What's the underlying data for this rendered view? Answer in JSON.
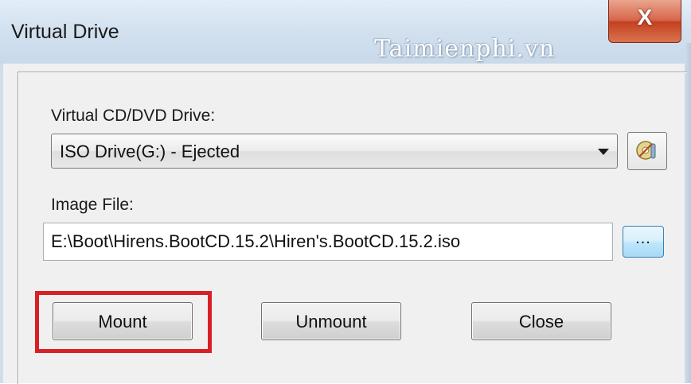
{
  "window": {
    "title": "Virtual Drive",
    "close_glyph": "X",
    "watermark": "Taimienphi.vn"
  },
  "drive": {
    "label": "Virtual CD/DVD Drive:",
    "selected": "ISO Drive(G:) - Ejected",
    "options_icon": "settings-icon"
  },
  "image": {
    "label": "Image File:",
    "value": "E:\\Boot\\Hirens.BootCD.15.2\\Hiren's.BootCD.15.2.iso",
    "browse_label": "..."
  },
  "buttons": {
    "mount": "Mount",
    "unmount": "Unmount",
    "close": "Close"
  },
  "colors": {
    "highlight": "#d92027",
    "close_button": "#c4401f",
    "browse_button": "#bee6fd"
  }
}
